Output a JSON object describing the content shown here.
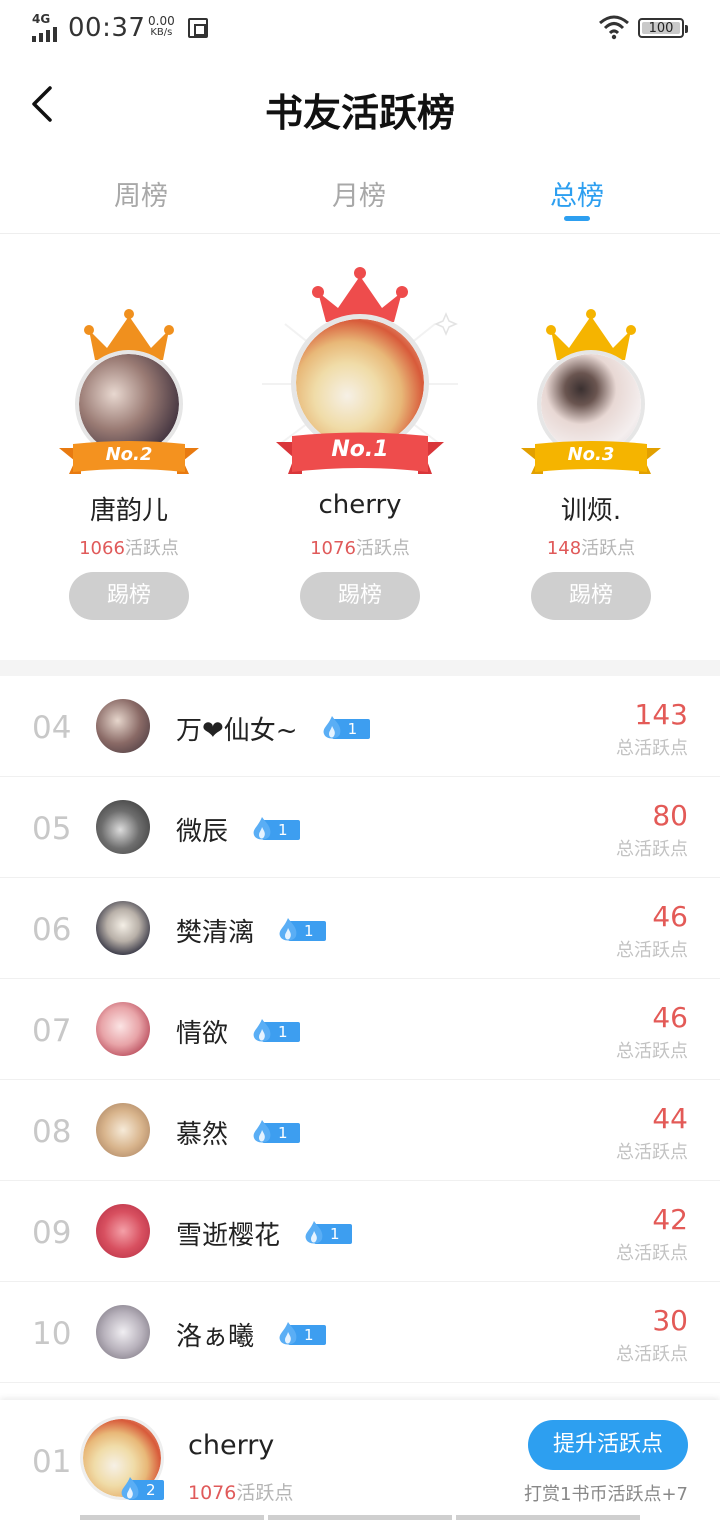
{
  "status_bar": {
    "network": "4G",
    "time": "00:37",
    "speed_value": "0.00",
    "speed_unit": "KB/s",
    "battery": "100"
  },
  "header": {
    "title": "书友活跃榜"
  },
  "tabs": [
    {
      "label": "周榜",
      "active": false
    },
    {
      "label": "月榜",
      "active": false
    },
    {
      "label": "总榜",
      "active": true
    }
  ],
  "podium": {
    "first": {
      "badge": "No.1",
      "name": "cherry",
      "points": "1076",
      "points_unit": "活跃点",
      "button": "踢榜"
    },
    "second": {
      "badge": "No.2",
      "name": "唐韵儿",
      "points": "1066",
      "points_unit": "活跃点",
      "button": "踢榜"
    },
    "third": {
      "badge": "No.3",
      "name": "训烦.",
      "points": "148",
      "points_unit": "活跃点",
      "button": "踢榜"
    }
  },
  "ranking": [
    {
      "rank": "04",
      "name": "万❤仙女~",
      "level": "1",
      "score": "143",
      "score_label": "总活跃点"
    },
    {
      "rank": "05",
      "name": "微辰",
      "level": "1",
      "score": "80",
      "score_label": "总活跃点"
    },
    {
      "rank": "06",
      "name": "樊清漓",
      "level": "1",
      "score": "46",
      "score_label": "总活跃点"
    },
    {
      "rank": "07",
      "name": "情欲",
      "level": "1",
      "score": "46",
      "score_label": "总活跃点"
    },
    {
      "rank": "08",
      "name": "慕然",
      "level": "1",
      "score": "44",
      "score_label": "总活跃点"
    },
    {
      "rank": "09",
      "name": "雪逝樱花",
      "level": "1",
      "score": "42",
      "score_label": "总活跃点"
    },
    {
      "rank": "10",
      "name": "洛ぁ曦",
      "level": "1",
      "score": "30",
      "score_label": "总活跃点"
    }
  ],
  "self": {
    "rank": "01",
    "name": "cherry",
    "level": "2",
    "points": "1076",
    "points_unit": "活跃点",
    "boost_button": "提升活跃点",
    "hint": "打赏1书币活跃点+7"
  },
  "colors": {
    "accent": "#2d9ff0",
    "score": "#e35a57",
    "gold": "#f5b400",
    "orange": "#f0901e",
    "red": "#ee4c4c"
  }
}
